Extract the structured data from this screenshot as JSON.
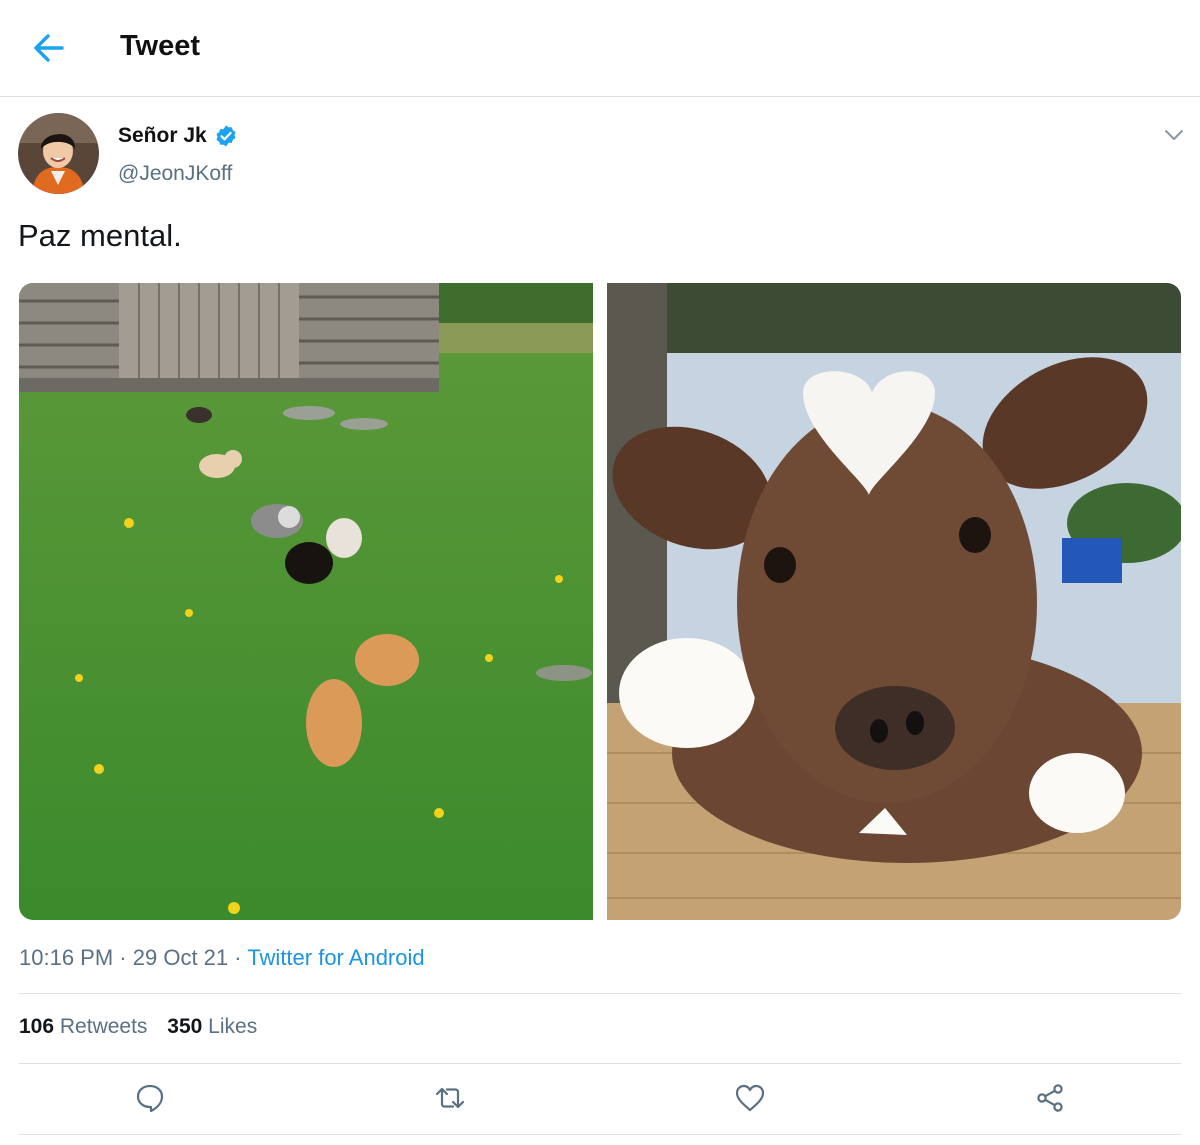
{
  "header": {
    "title": "Tweet"
  },
  "author": {
    "display_name": "Señor Jk",
    "handle": "@JeonJKoff"
  },
  "tweet": {
    "text": "Paz mental."
  },
  "meta": {
    "time": "10:16 PM",
    "date": "29 Oct 21",
    "separator": "·",
    "source": "Twitter for Android"
  },
  "stats": {
    "retweets_count": "106",
    "retweets_label": "Retweets",
    "likes_count": "350",
    "likes_label": "Likes"
  },
  "icons": {
    "back": "back-arrow-icon",
    "verified": "verified-badge-icon",
    "more": "chevron-down-icon",
    "reply": "reply-icon",
    "retweet": "retweet-icon",
    "like": "heart-icon",
    "share": "share-icon"
  },
  "colors": {
    "accent": "#1da1f2",
    "link": "#1b95e0",
    "secondary_text": "#5b7083",
    "divider": "#dbe1e6"
  }
}
